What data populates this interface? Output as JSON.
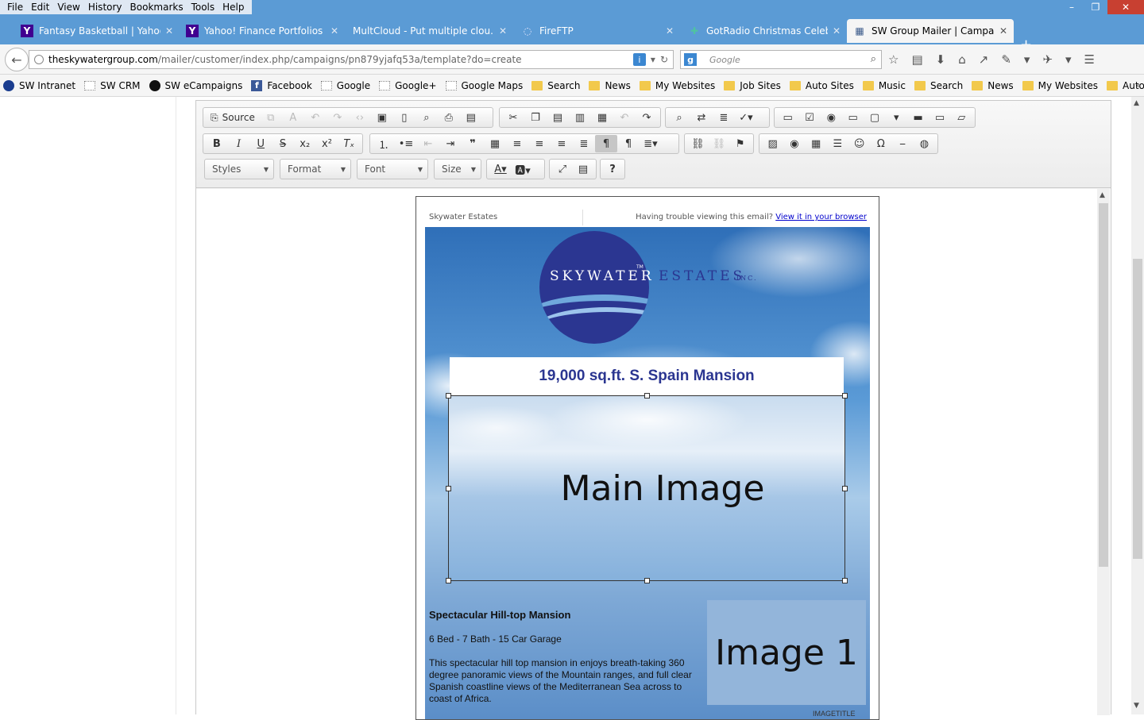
{
  "menu": [
    {
      "label": "File"
    },
    {
      "label": "Edit"
    },
    {
      "label": "View"
    },
    {
      "label": "History"
    },
    {
      "label": "Bookmarks"
    },
    {
      "label": "Tools"
    },
    {
      "label": "Help"
    }
  ],
  "window_controls": {
    "minimize": "–",
    "restore": "❐",
    "close": "✕"
  },
  "tabs": [
    {
      "title": "Fantasy Basketball | Yahoo ...",
      "icon": "yahoo-icon",
      "fav": "Y"
    },
    {
      "title": "Yahoo! Finance Portfolios",
      "icon": "yahoo-icon",
      "fav": "Y"
    },
    {
      "title": "MultCloud - Put multiple clou...",
      "icon": "none",
      "fav": ""
    },
    {
      "title": "FireFTP",
      "icon": "fireftp-icon",
      "fav": "◌"
    },
    {
      "title": "GotRadio Christmas Celebr...",
      "icon": "gotradio-icon",
      "fav": "✚"
    },
    {
      "title": "SW Group Mailer | Campai...",
      "icon": "mailer-icon",
      "fav": "▦"
    }
  ],
  "address": {
    "host": "theskywatergroup.com",
    "path": "/mailer/customer/index.php/campaigns/pn879yjafq53a/template?do=create"
  },
  "search": {
    "engine": "g",
    "placeholder": "Google"
  },
  "bookmarks": [
    {
      "label": "SW Intranet",
      "icon": "circle"
    },
    {
      "label": "SW CRM",
      "icon": "page"
    },
    {
      "label": "SW eCampaigns",
      "icon": "dark"
    },
    {
      "label": "Facebook",
      "icon": "fb"
    },
    {
      "label": "Google",
      "icon": "page"
    },
    {
      "label": "Google+",
      "icon": "page"
    },
    {
      "label": "Google Maps",
      "icon": "page"
    },
    {
      "label": "Search",
      "icon": "folder"
    },
    {
      "label": "News",
      "icon": "folder"
    },
    {
      "label": "My Websites",
      "icon": "folder"
    },
    {
      "label": "Job Sites",
      "icon": "folder"
    },
    {
      "label": "Auto Sites",
      "icon": "folder"
    },
    {
      "label": "Music",
      "icon": "folder"
    },
    {
      "label": "Search",
      "icon": "folder"
    },
    {
      "label": "News",
      "icon": "folder"
    },
    {
      "label": "My Websites",
      "icon": "folder"
    },
    {
      "label": "Auto Sites",
      "icon": "folder"
    }
  ],
  "editor": {
    "source_label": "Source",
    "combos": {
      "styles": "Styles",
      "format": "Format",
      "font": "Font",
      "size": "Size"
    }
  },
  "email": {
    "sender": "Skywater Estates",
    "trouble_text": "Having trouble viewing this email?",
    "view_link": "View it in your browser",
    "brand_word1": "SKYWATER",
    "brand_tm": "TM",
    "brand_word2": "ESTATES",
    "brand_inc": "INC.",
    "headline": "19,000 sq.ft. S. Spain Mansion",
    "main_image_label": "Main Image",
    "image1_label": "Image 1",
    "property_title": "Spectacular Hill-top Mansion",
    "property_specs": "6 Bed - 7 Bath - 15 Car Garage",
    "property_desc": "This spectacular hill top mansion in enjoys breath-taking 360 degree panoramic views of the Mountain ranges, and full clear Spanish coastline views of the Mediterranean Sea across to coast of Africa.",
    "caption": "IMAGETITLE"
  }
}
